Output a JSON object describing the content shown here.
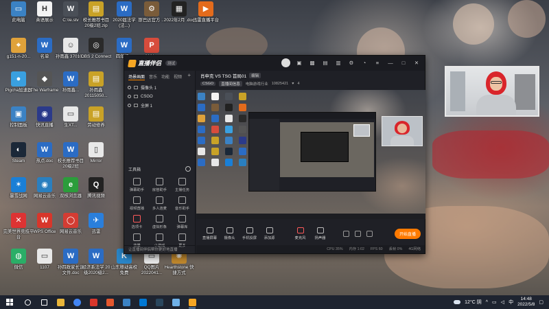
{
  "desktop": {
    "icons": [
      {
        "label": "此电脑",
        "color": "#3b82c4",
        "glyph": "▭"
      },
      {
        "label": "英语展示",
        "color": "#f3f3f3",
        "glyph": "H"
      },
      {
        "label": "C:\\Ie.stv",
        "color": "#4a4f57",
        "glyph": "W"
      },
      {
        "label": "校长推荐书目 20级2班.zip",
        "color": "#c9a227",
        "glyph": "▤"
      },
      {
        "label": "2020届法学 (法...)",
        "color": "#2b6cc4",
        "glyph": "W"
      },
      {
        "label": "斯巴达官方 ...",
        "color": "#7a5c3a",
        "glyph": "⚙"
      },
      {
        "label": "2022年2月 .doc",
        "color": "#222",
        "glyph": "▦"
      },
      {
        "label": "迅雷直播平台",
        "color": "#e36b1c",
        "glyph": "▶"
      },
      {
        "label": "g151-n-20...",
        "color": "#e0a23a",
        "glyph": "⌖"
      },
      {
        "label": "名单",
        "color": "#2b6cc4",
        "glyph": "W"
      },
      {
        "label": "孙雨鑫 37010...",
        "color": "#e8e8e8",
        "glyph": "☺"
      },
      {
        "label": "OBS 2 Connect",
        "color": "#2a2a2a",
        "glyph": "◎"
      },
      {
        "label": "四年级...",
        "color": "#2b6cc4",
        "glyph": "W"
      },
      {
        "label": "2021...",
        "color": "#d74c3c",
        "glyph": "P"
      },
      {
        "label": "Pigcha加速器",
        "color": "#3aa0e0",
        "glyph": "●"
      },
      {
        "label": "The Warframe",
        "color": "#555",
        "glyph": "◆"
      },
      {
        "label": "孙雨鑫...",
        "color": "#2b6cc4",
        "glyph": "W"
      },
      {
        "label": "孙雨鑫 20115050...",
        "color": "#c9a227",
        "glyph": "▤"
      },
      {
        "label": "控制面板",
        "color": "#3b82c4",
        "glyph": "▣"
      },
      {
        "label": "快讯直播",
        "color": "#2b3a8a",
        "glyph": "◉"
      },
      {
        "label": "生XT...",
        "color": "#e8e8e8",
        "glyph": "▭"
      },
      {
        "label": "劳动修养",
        "color": "#c9a227",
        "glyph": "▤"
      },
      {
        "label": "Steam",
        "color": "#1b2838",
        "glyph": "◐"
      },
      {
        "label": "热点.doc",
        "color": "#2b6cc4",
        "glyph": "W"
      },
      {
        "label": "校长推荐书目 20级2班",
        "color": "#2b6cc4",
        "glyph": "W"
      },
      {
        "label": "Mirror",
        "color": "#e8e8e8",
        "glyph": "▯"
      },
      {
        "label": "暴雪战网",
        "color": "#1a7fd6",
        "glyph": "✶"
      },
      {
        "label": "网易云音乐",
        "color": "#2a7fbf",
        "glyph": "◉"
      },
      {
        "label": "双核浏览器",
        "color": "#2b9d3b",
        "glyph": "e"
      },
      {
        "label": "腾讯视频",
        "color": "#222",
        "glyph": "Q"
      },
      {
        "label": "完美世界竞技平台",
        "color": "#d33",
        "glyph": "✕"
      },
      {
        "label": "WPS Office",
        "color": "#d8362b",
        "glyph": "W"
      },
      {
        "label": "网易云音乐",
        "color": "#d43c33",
        "glyph": "◯"
      },
      {
        "label": "迅雷",
        "color": "#2a7fdc",
        "glyph": "✈"
      },
      {
        "label": "微信",
        "color": "#2aae67",
        "glyph": "◍"
      },
      {
        "label": "1107",
        "color": "#e8e8e8",
        "glyph": "▭"
      },
      {
        "label": "孙四政家长谈 文件.doc",
        "color": "#2b6cc4",
        "glyph": "W"
      },
      {
        "label": "经济系法学 20级2020级2...",
        "color": "#2b6cc4",
        "glyph": "W"
      },
      {
        "label": "山东移动高校 免费",
        "color": "#2a86c9",
        "glyph": "K"
      },
      {
        "label": "QQ图片 2022041...",
        "color": "#e8e8e8",
        "glyph": "▭"
      },
      {
        "label": "Hearthstone 快捷方式",
        "color": "#c0882d",
        "glyph": "✺"
      }
    ]
  },
  "app": {
    "logo_text": "直播伴侣",
    "badge": "测试",
    "top_icons": [
      "avatar",
      "notice-icon",
      "gift-icon",
      "bag-icon",
      "lock-icon",
      "settings-icon",
      "bell-icon",
      "menu-icon"
    ],
    "window_controls": {
      "minimize": "—",
      "maximize": "□",
      "close": "✕"
    },
    "left_tabs": [
      "场景画面",
      "音乐",
      "功能",
      "视频",
      "+"
    ],
    "scenes": [
      {
        "label": "摄像头 1"
      },
      {
        "label": "CSGO"
      },
      {
        "label": "全屏 1"
      }
    ],
    "tools_title": "工具箱",
    "tools": [
      {
        "label": "弹幕助手",
        "highlight": false
      },
      {
        "label": "房管助手",
        "highlight": false
      },
      {
        "label": "主播任务",
        "highlight": false
      },
      {
        "label": "视频直播",
        "highlight": false
      },
      {
        "label": "多人连麦",
        "highlight": false
      },
      {
        "label": "音乐助手",
        "highlight": false
      },
      {
        "label": "选项卡",
        "highlight": true
      },
      {
        "label": "虚拟形象",
        "highlight": false
      },
      {
        "label": "弹幕库",
        "highlight": false
      },
      {
        "label": "背景",
        "highlight": false
      },
      {
        "label": "小游戏",
        "highlight": false
      },
      {
        "label": "更多",
        "highlight": false
      }
    ],
    "left_footer": "让直播间伴侣帮你更好地直播",
    "stage_title": "肖申克 VS TSG 首局01",
    "stage_title_tag": "编辑",
    "stage_sub": {
      "category": "CSGO",
      "room": "直播间信息",
      "sub_label": "电脑游戏行业",
      "followers": "10825421",
      "likes": "4"
    },
    "controls": [
      {
        "label": "直播屏幕",
        "name": "screen-share"
      },
      {
        "label": "摄像头",
        "name": "camera"
      },
      {
        "label": "手机投屏",
        "name": "phone-cast"
      },
      {
        "label": "添加源",
        "name": "add-source"
      },
      {
        "label": "麦克风",
        "name": "microphone"
      },
      {
        "label": "扬声器",
        "name": "speaker"
      }
    ],
    "go_live_label": "开始直播",
    "status": [
      "CPU 35%",
      "内存 1:02",
      "FPS 60",
      "丢帧 0%",
      "4G网络"
    ]
  },
  "taskbar": {
    "apps": [
      {
        "name": "search-icon",
        "color": "#ffffff"
      },
      {
        "name": "task-view-icon",
        "color": "#ffffff"
      },
      {
        "name": "file-explorer-icon",
        "color": "#e8b53a"
      },
      {
        "name": "chrome-icon",
        "color": "#4285f4"
      },
      {
        "name": "wps-icon",
        "color": "#d8362b"
      },
      {
        "name": "gamepad-icon",
        "color": "#e4572e"
      },
      {
        "name": "mail-icon",
        "color": "#3b82c4"
      },
      {
        "name": "store-icon",
        "color": "#0078d4"
      },
      {
        "name": "steam-icon",
        "color": "#2a475e"
      },
      {
        "name": "tencent-icon",
        "color": "#6fb1e8"
      },
      {
        "name": "live-companion-icon",
        "color": "#f5a623"
      }
    ],
    "weather": "12°C 阴",
    "time": "14:48",
    "date": "2022/5/8"
  }
}
